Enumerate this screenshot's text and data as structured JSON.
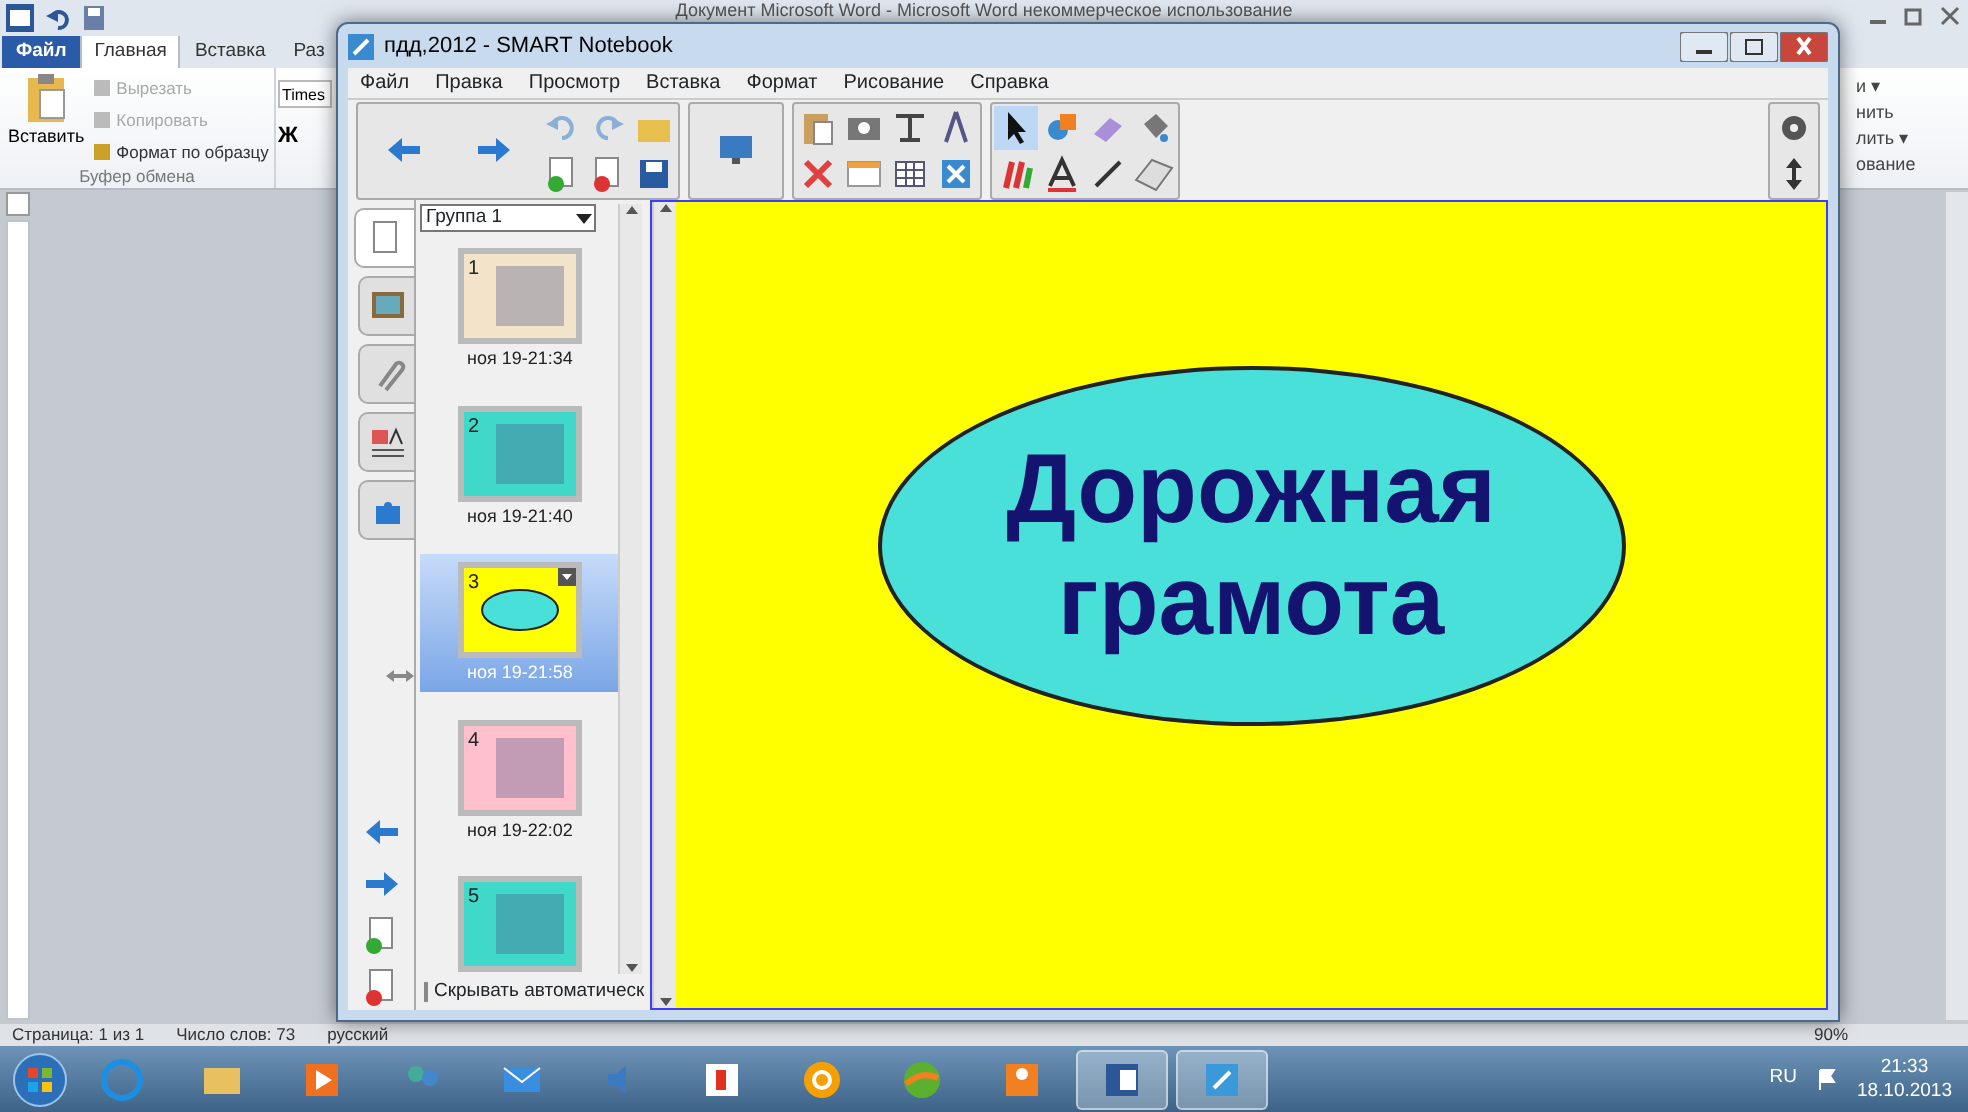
{
  "word_window": {
    "title": "Документ Microsoft Word  -  Microsoft Word некоммерческое использование",
    "tabs": [
      {
        "label": "Файл",
        "kind": "file",
        "selected": false
      },
      {
        "label": "Главная",
        "kind": "tab",
        "selected": true
      },
      {
        "label": "Вставка",
        "kind": "tab",
        "selected": false
      },
      {
        "label": "Раз",
        "kind": "tab",
        "selected": false
      }
    ],
    "clipboard": {
      "paste": "Вставить",
      "cut": "Вырезать",
      "copy": "Копировать",
      "format_painter": "Формат по образцу",
      "group_label": "Буфер обмена"
    },
    "font_box": {
      "value": "Times"
    },
    "bold_button": "Ж",
    "right_fragments": [
      "и ▾",
      "нить",
      "лить ▾",
      "ование"
    ],
    "status_bar": {
      "page": "Страница: 1 из 1",
      "words": "Число слов: 73",
      "language": "русский",
      "zoom": "90%"
    }
  },
  "notebook_window": {
    "title": "пдд,2012 - SMART Notebook",
    "menu": [
      "Файл",
      "Правка",
      "Просмотр",
      "Вставка",
      "Формат",
      "Рисование",
      "Справка"
    ],
    "side_tabs": [
      {
        "kind": "pages",
        "selected": true
      },
      {
        "kind": "gallery",
        "selected": false
      },
      {
        "kind": "attachments",
        "selected": false
      },
      {
        "kind": "properties",
        "selected": false
      },
      {
        "kind": "addons",
        "selected": false
      }
    ],
    "group_select": {
      "value": "Группа 1"
    },
    "pages": [
      {
        "number": "1",
        "time": "ноя 19-21:34",
        "kind": "image",
        "color": "#f3e3c8",
        "selected": false
      },
      {
        "number": "2",
        "time": "ноя 19-21:40",
        "kind": "image",
        "color": "#40d8c8",
        "selected": false
      },
      {
        "number": "3",
        "time": "ноя 19-21:58",
        "kind": "shape",
        "color": "#ffff00",
        "selected": true
      },
      {
        "number": "4",
        "time": "ноя 19-22:02",
        "kind": "image",
        "color": "#ffc0cb",
        "selected": false
      },
      {
        "number": "5",
        "kind": "image",
        "color": "#40d8c8",
        "selected": false
      }
    ],
    "auto_hide": {
      "label": "Скрывать автоматическ",
      "checked": false
    },
    "slide": {
      "title_lines": [
        "Дорожная",
        "грамота"
      ]
    }
  },
  "taskbar": {
    "language": "RU",
    "time": "21:33",
    "date": "18.10.2013"
  }
}
